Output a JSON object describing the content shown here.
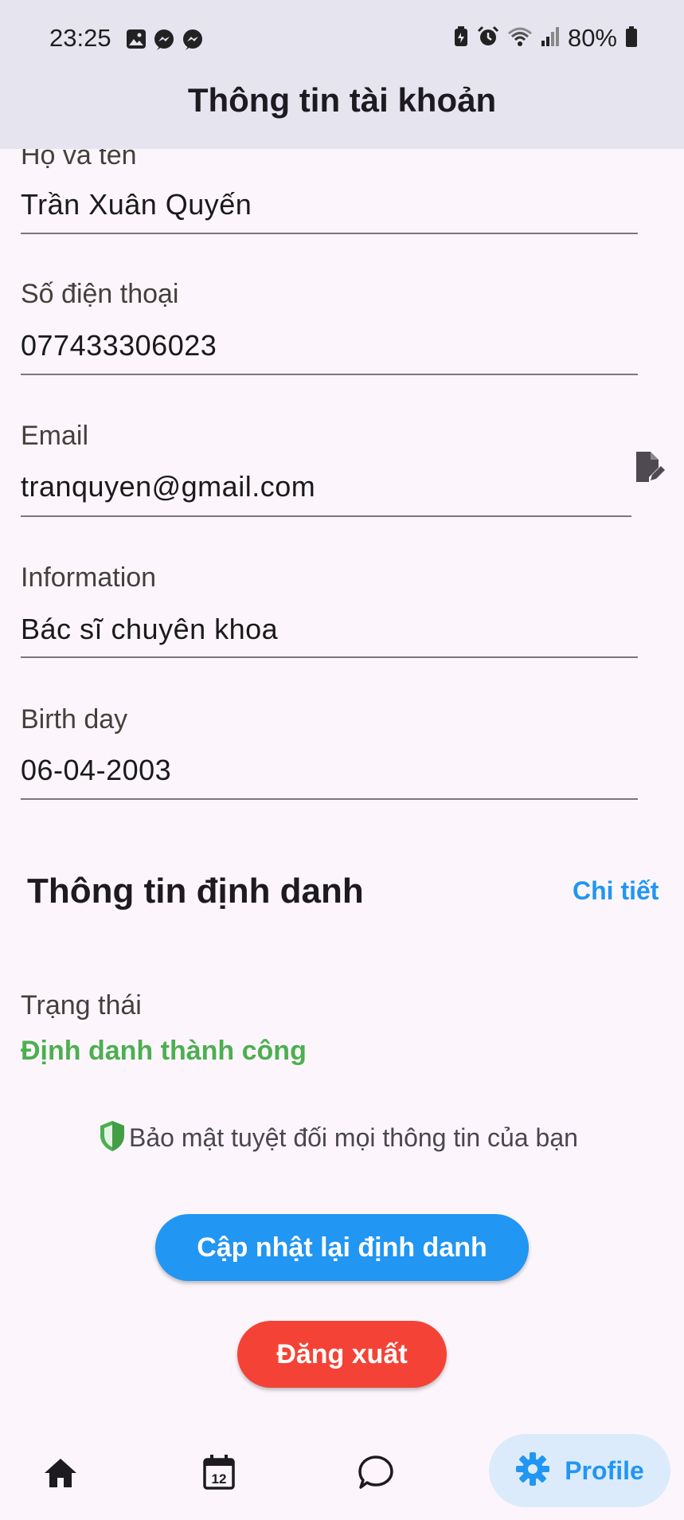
{
  "status_bar": {
    "time": "23:25",
    "battery": "80%",
    "left_icons": [
      "gallery-icon",
      "messenger-icon",
      "messenger-icon"
    ],
    "right_icons": [
      "battery-saver-icon",
      "alarm-icon",
      "wifi-icon",
      "signal-icon",
      "battery-icon"
    ]
  },
  "header": {
    "title": "Thông tin tài khoản"
  },
  "fields": [
    {
      "label": "Họ và tên",
      "value": "Trần Xuân Quyến"
    },
    {
      "label": "Số điện thoại",
      "value": "077433306023"
    },
    {
      "label": "Email",
      "value": "tranquyen@gmail.com",
      "editable_icon": "edit-document-icon"
    },
    {
      "label": "Information",
      "value": "Bác sĩ chuyên khoa"
    },
    {
      "label": "Birth day",
      "value": "06-04-2003"
    }
  ],
  "identity": {
    "title": "Thông tin định danh",
    "detail_link": "Chi tiết",
    "status_label": "Trạng thái",
    "status_value": "Định danh thành công",
    "security_note": "Bảo mật tuyệt đối mọi thông tin của bạn"
  },
  "buttons": {
    "update_identity": "Cập nhật lại định danh",
    "logout": "Đăng xuất"
  },
  "bottom_nav": {
    "items": [
      {
        "icon": "home-icon",
        "label": ""
      },
      {
        "icon": "calendar-icon",
        "label": "",
        "badge_text": "12"
      },
      {
        "icon": "chat-icon",
        "label": ""
      },
      {
        "icon": "gear-icon",
        "label": "Profile",
        "active": true
      }
    ]
  },
  "colors": {
    "primary": "#2196f3",
    "danger": "#f44336",
    "success": "#4caf50",
    "header_bg": "#e6e4ef",
    "page_bg": "#fcf6fc"
  }
}
